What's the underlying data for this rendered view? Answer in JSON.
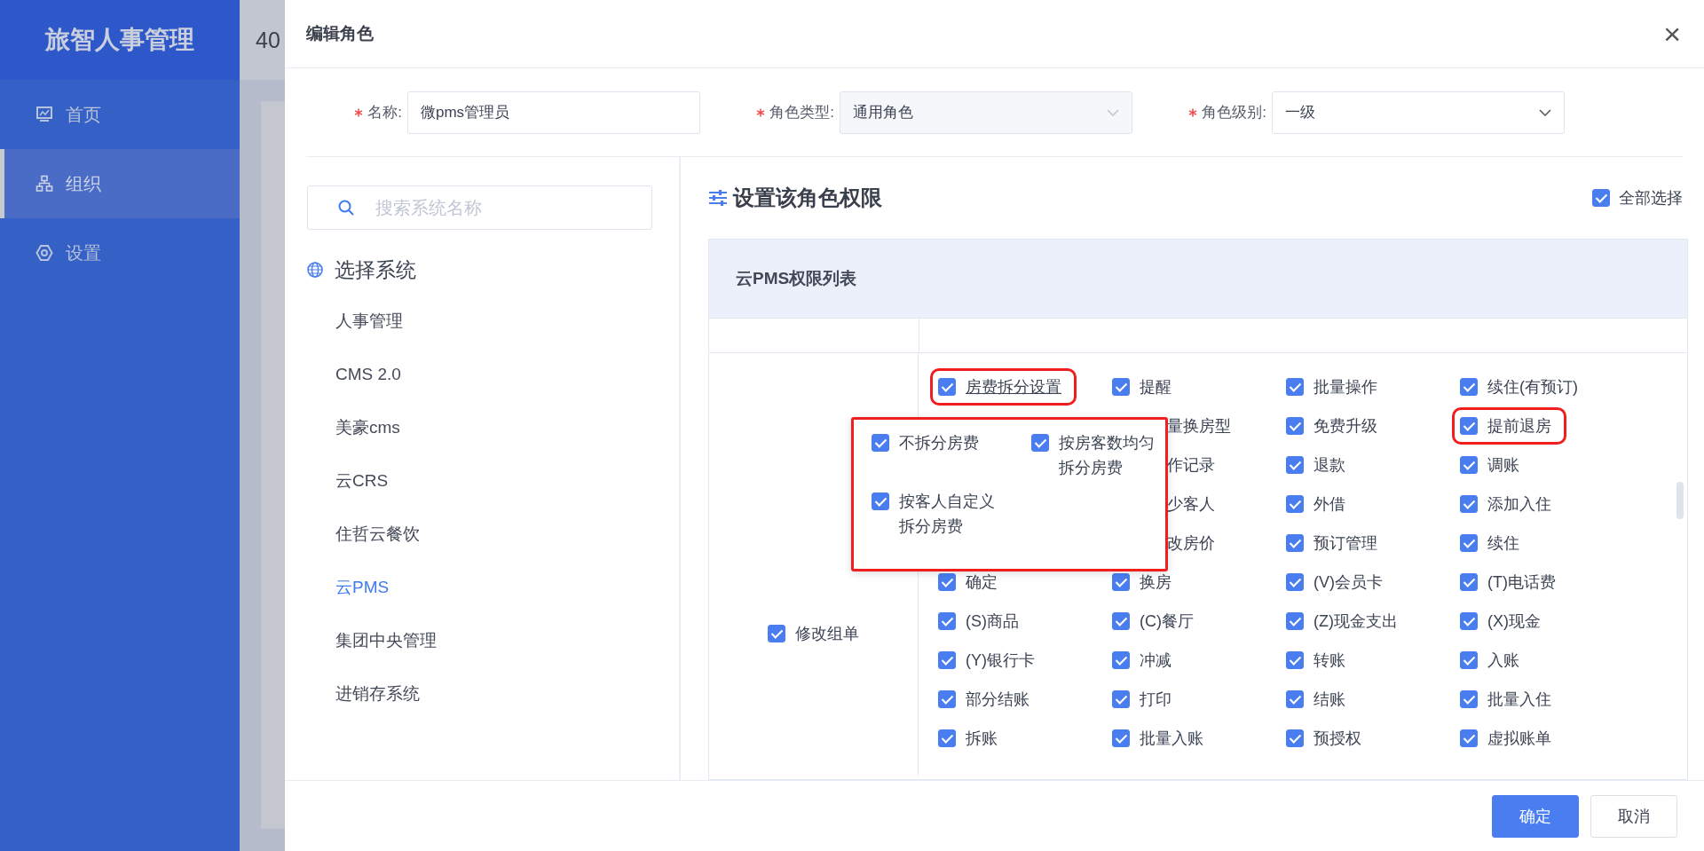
{
  "sidebar": {
    "logo": "旅智人事管理",
    "items": [
      {
        "label": "首页",
        "selected": false
      },
      {
        "label": "组织",
        "selected": true
      },
      {
        "label": "设置",
        "selected": false
      }
    ]
  },
  "background_header_text": "40",
  "dialog": {
    "title": "编辑角色",
    "close": "×",
    "form": [
      {
        "label": "名称:",
        "required": true,
        "kind": "input",
        "value": "微pms管理员",
        "disabled": false
      },
      {
        "label": "角色类型:",
        "required": true,
        "kind": "select",
        "value": "通用角色",
        "disabled": true
      },
      {
        "label": "角色级别:",
        "required": true,
        "kind": "select",
        "value": "一级",
        "disabled": false
      }
    ],
    "search": {
      "placeholder": "搜索系统名称"
    },
    "systems_title": "选择系统",
    "systems": [
      {
        "label": "人事管理",
        "selected": false
      },
      {
        "label": "CMS 2.0",
        "selected": false
      },
      {
        "label": "美豪cms",
        "selected": false
      },
      {
        "label": "云CRS",
        "selected": false
      },
      {
        "label": "住哲云餐饮",
        "selected": false
      },
      {
        "label": "云PMS",
        "selected": true
      },
      {
        "label": "集团中央管理",
        "selected": false
      },
      {
        "label": "进销存系统",
        "selected": false
      }
    ],
    "permissions_title": "设置该角色权限",
    "select_all": {
      "label": "全部选择",
      "checked": true
    },
    "table_title": "云PMS权限列表",
    "group": {
      "label": "修改组单",
      "checked": true
    },
    "rows": [
      [
        {
          "kind": "link",
          "label": "房费拆分设置",
          "checked": true,
          "highlighted": true
        },
        {
          "kind": "item",
          "label": "提醒",
          "checked": true,
          "highlighted": false
        },
        {
          "kind": "item",
          "label": "批量操作",
          "checked": true,
          "highlighted": false
        },
        {
          "kind": "item",
          "label": "续住(有预订)",
          "checked": true,
          "highlighted": false
        }
      ],
      [
        {
          "kind": "cut",
          "label": "量换房型"
        },
        {
          "kind": "item",
          "label": "免费升级",
          "checked": true,
          "highlighted": false
        },
        {
          "kind": "item",
          "label": "提前退房",
          "checked": true,
          "highlighted": true
        }
      ],
      [
        {
          "kind": "cut",
          "label": "作记录"
        },
        {
          "kind": "item",
          "label": "退款",
          "checked": true,
          "highlighted": false
        },
        {
          "kind": "item",
          "label": "调账",
          "checked": true,
          "highlighted": false
        }
      ],
      [
        {
          "kind": "cut",
          "label": "少客人"
        },
        {
          "kind": "item",
          "label": "外借",
          "checked": true,
          "highlighted": false
        },
        {
          "kind": "item",
          "label": "添加入住",
          "checked": true,
          "highlighted": false
        }
      ],
      [
        {
          "kind": "cut",
          "label": "改房价"
        },
        {
          "kind": "item",
          "label": "预订管理",
          "checked": true,
          "highlighted": false
        },
        {
          "kind": "item",
          "label": "续住",
          "checked": true,
          "highlighted": false
        }
      ],
      [
        {
          "kind": "item",
          "label": "确定",
          "checked": true,
          "highlighted": false
        },
        {
          "kind": "item",
          "label": "换房",
          "checked": true,
          "highlighted": false
        },
        {
          "kind": "item",
          "label": "(V)会员卡",
          "checked": true,
          "highlighted": false
        },
        {
          "kind": "item",
          "label": "(T)电话费",
          "checked": true,
          "highlighted": false
        }
      ],
      [
        {
          "kind": "item",
          "label": "(S)商品",
          "checked": true,
          "highlighted": false
        },
        {
          "kind": "item",
          "label": "(C)餐厅",
          "checked": true,
          "highlighted": false
        },
        {
          "kind": "item",
          "label": "(Z)现金支出",
          "checked": true,
          "highlighted": false
        },
        {
          "kind": "item",
          "label": "(X)现金",
          "checked": true,
          "highlighted": false
        }
      ],
      [
        {
          "kind": "item",
          "label": "(Y)银行卡",
          "checked": true,
          "highlighted": false
        },
        {
          "kind": "item",
          "label": "冲减",
          "checked": true,
          "highlighted": false
        },
        {
          "kind": "item",
          "label": "转账",
          "checked": true,
          "highlighted": false
        },
        {
          "kind": "item",
          "label": "入账",
          "checked": true,
          "highlighted": false
        }
      ],
      [
        {
          "kind": "item",
          "label": "部分结账",
          "checked": true,
          "highlighted": false
        },
        {
          "kind": "item",
          "label": "打印",
          "checked": true,
          "highlighted": false
        },
        {
          "kind": "item",
          "label": "结账",
          "checked": true,
          "highlighted": false
        },
        {
          "kind": "item",
          "label": "批量入住",
          "checked": true,
          "highlighted": false
        }
      ],
      [
        {
          "kind": "item",
          "label": "拆账",
          "checked": true,
          "highlighted": false
        },
        {
          "kind": "item",
          "label": "批量入账",
          "checked": true,
          "highlighted": false
        },
        {
          "kind": "item",
          "label": "预授权",
          "checked": true,
          "highlighted": false
        },
        {
          "kind": "item",
          "label": "虚拟账单",
          "checked": true,
          "highlighted": false
        }
      ]
    ],
    "popup": {
      "highlighted": true,
      "items": [
        {
          "label": "不拆分房费",
          "checked": true
        },
        {
          "label": "按房客数均匀拆分房费",
          "checked": true
        },
        {
          "label": "按客人自定义拆分房费",
          "checked": true
        }
      ]
    },
    "buttons": [
      {
        "label": "确定",
        "kind": "primary"
      },
      {
        "label": "取消",
        "kind": "default"
      }
    ]
  }
}
